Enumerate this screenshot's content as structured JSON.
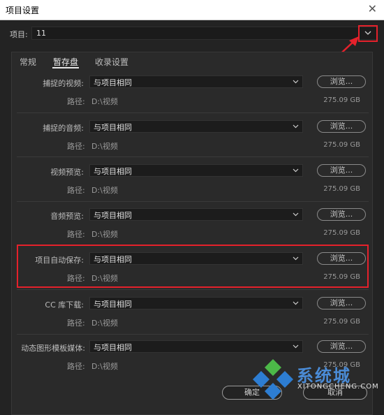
{
  "window": {
    "title": "项目设置"
  },
  "project": {
    "label": "项目:",
    "value": "11"
  },
  "tabs": [
    {
      "label": "常规"
    },
    {
      "label": "暂存盘"
    },
    {
      "label": "收录设置"
    }
  ],
  "rows": [
    {
      "label": "捕捉的视频:",
      "select": "与项目相同",
      "browse": "浏览...",
      "path_label": "路径:",
      "path": "D:\\视频",
      "size": "275.09 GB"
    },
    {
      "label": "捕捉的音频:",
      "select": "与项目相同",
      "browse": "浏览...",
      "path_label": "路径:",
      "path": "D:\\视频",
      "size": "275.09 GB"
    },
    {
      "label": "视频预览:",
      "select": "与项目相同",
      "browse": "浏览...",
      "path_label": "路径:",
      "path": "D:\\视频",
      "size": "275.09 GB"
    },
    {
      "label": "音频预览:",
      "select": "与项目相同",
      "browse": "浏览...",
      "path_label": "路径:",
      "path": "D:\\视频",
      "size": "275.09 GB"
    },
    {
      "label": "项目自动保存:",
      "select": "与项目相同",
      "browse": "浏览...",
      "path_label": "路径:",
      "path": "D:\\视频",
      "size": "275.09 GB"
    },
    {
      "label": "CC 库下载:",
      "select": "与项目相同",
      "browse": "浏览...",
      "path_label": "路径:",
      "path": "D:\\视频",
      "size": "275.09 GB"
    },
    {
      "label": "动态图形模板媒体:",
      "select": "与项目相同",
      "browse": "浏览...",
      "path_label": "路径:",
      "path": "D:\\视频",
      "size": "275.09 GB"
    }
  ],
  "buttons": {
    "ok": "确定",
    "cancel": "取消"
  },
  "watermark": {
    "text": "系统城",
    "sub": "XITONGCHENG.COM"
  },
  "colors": {
    "highlight": "#e5212b",
    "background": "#232323",
    "watermark_blue": "#4a8bd6"
  }
}
